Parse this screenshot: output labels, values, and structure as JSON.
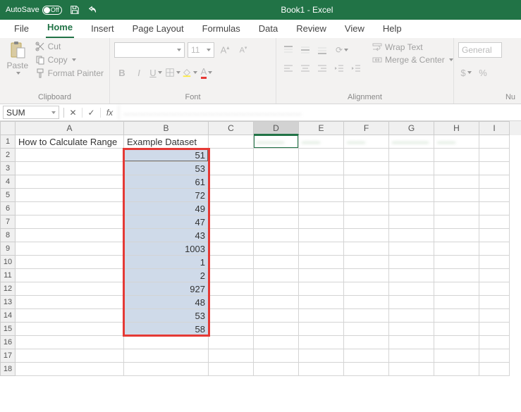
{
  "titlebar": {
    "autosave_label": "AutoSave",
    "autosave_state": "Off",
    "doc_title": "Book1 - Excel"
  },
  "tabs": {
    "file": "File",
    "home": "Home",
    "insert": "Insert",
    "page_layout": "Page Layout",
    "formulas": "Formulas",
    "data": "Data",
    "review": "Review",
    "view": "View",
    "help": "Help"
  },
  "ribbon": {
    "paste": "Paste",
    "cut": "Cut",
    "copy": "Copy",
    "format_painter": "Format Painter",
    "clipboard": "Clipboard",
    "font_name": "",
    "font_size": "11",
    "font_group": "Font",
    "wrap": "Wrap Text",
    "merge": "Merge & Center",
    "alignment": "Alignment",
    "num_format": "General",
    "number": "Nu"
  },
  "formula_bar": {
    "name_box": "SUM",
    "formula_blur": "……………………………………………………………"
  },
  "columns": [
    "A",
    "B",
    "C",
    "D",
    "E",
    "F",
    "G",
    "H",
    "I"
  ],
  "row_headers": [
    1,
    2,
    3,
    4,
    5,
    6,
    7,
    8,
    9,
    10,
    11,
    12,
    13,
    14,
    15,
    16,
    17,
    18
  ],
  "cells": {
    "A1": "How to Calculate Range",
    "B1": "Example Dataset",
    "B2": 51,
    "B3": 53,
    "B4": 61,
    "B5": 72,
    "B6": 49,
    "B7": 47,
    "B8": 43,
    "B9": 1003,
    "B10": 1,
    "B11": 2,
    "B12": 927,
    "B13": 48,
    "B14": 53,
    "B15": 58
  },
  "selection": {
    "range": "B2:B15",
    "anchor_cell": "D1"
  },
  "highlight_box": {
    "note": "red overlay around B2:B15"
  }
}
